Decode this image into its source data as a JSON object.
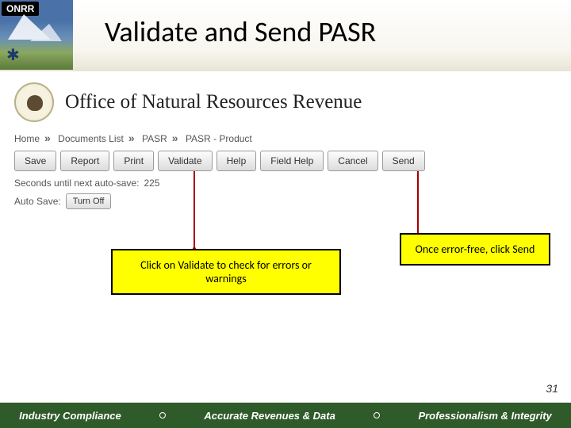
{
  "header": {
    "logo_text": "ONRR",
    "title": "Validate and Send PASR"
  },
  "app": {
    "office_title": "Office of Natural Resources Revenue",
    "breadcrumb": [
      "Home",
      "Documents List",
      "PASR",
      "PASR - Product"
    ],
    "buttons": {
      "save": "Save",
      "report": "Report",
      "print": "Print",
      "validate": "Validate",
      "help": "Help",
      "field_help": "Field Help",
      "cancel": "Cancel",
      "send": "Send"
    },
    "autosave_label": "Seconds until next auto-save:",
    "autosave_seconds": "225",
    "autosave_toggle_label": "Auto Save:",
    "autosave_toggle_btn": "Turn Off"
  },
  "callouts": {
    "validate": "Click on Validate to check for errors or warnings",
    "send": "Once error-free, click Send"
  },
  "footer": {
    "a": "Industry Compliance",
    "b": "Accurate Revenues & Data",
    "c": "Professionalism & Integrity"
  },
  "page_number": "31"
}
